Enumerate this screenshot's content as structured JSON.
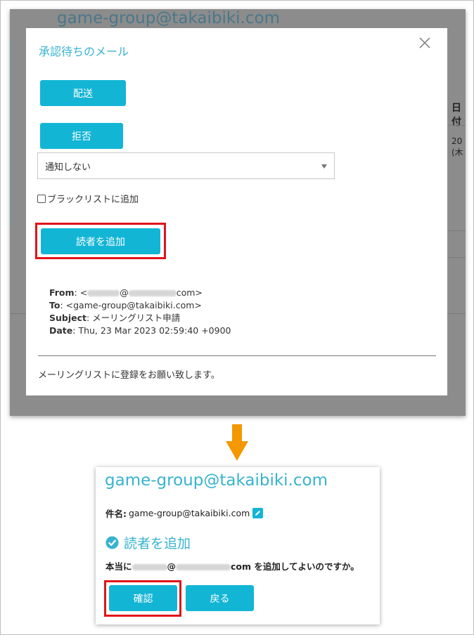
{
  "top": {
    "background_title": "game-group@takaibiki.com",
    "background_column_header": "日付",
    "background_column_value_line1": "20",
    "background_column_value_line2": "(木",
    "modal": {
      "title": "承認待ちのメール",
      "deliver_label": "配送",
      "reject_label": "拒否",
      "notify_select_value": "通知しない",
      "blacklist_label": "ブラックリストに追加",
      "add_reader_label": "読者を追加",
      "mail": {
        "from_key": "From",
        "from_prefix": ": <",
        "from_at": "@",
        "from_suffix": "com>",
        "to_key": "To",
        "to_value": ": <game-group@takaibiki.com>",
        "subject_key": "Subject",
        "subject_value": ": メーリングリスト申請",
        "date_key": "Date",
        "date_value": ": Thu, 23 Mar 2023 02:59:40 +0900"
      },
      "body_text": "メーリングリストに登録をお願い致します。"
    }
  },
  "bottom": {
    "title": "game-group@takaibiki.com",
    "subject_key": "件名:",
    "subject_value": "game-group@takaibiki.com",
    "heading": "読者を追加",
    "question_prefix": "本当に",
    "question_at": "@",
    "question_suffix": "com を追加してよいのですか。",
    "confirm_label": "確認",
    "back_label": "戻る"
  },
  "colors": {
    "accent": "#13b5d5",
    "highlight_frame": "#e0141a",
    "arrow": "#f39800",
    "overlay": "#8c8c8c"
  }
}
